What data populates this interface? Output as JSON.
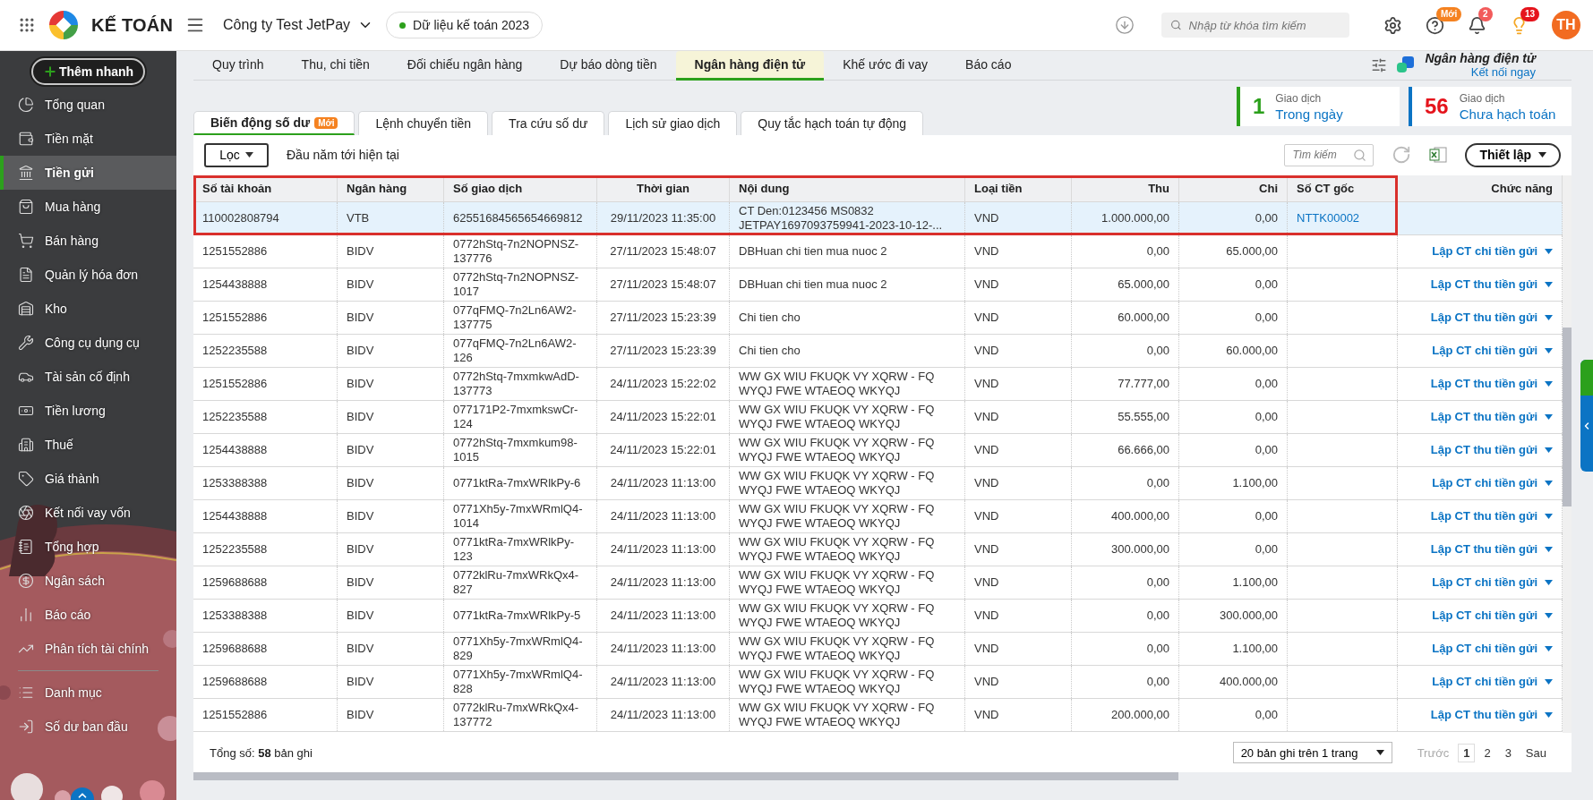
{
  "topbar": {
    "brand": "KẾ TOÁN",
    "company": "Công ty Test JetPay",
    "data_pill": "Dữ liệu kế toán 2023",
    "search": {
      "placeholder": "Nhập từ khóa tìm kiếm"
    },
    "help_badge": "Mới",
    "bell_badge": "2",
    "tips_badge": "13",
    "avatar": "TH"
  },
  "sidebar": {
    "add_button": "Thêm nhanh",
    "sections": [
      {
        "items": [
          {
            "label": "Tổng quan",
            "selected": false
          },
          {
            "label": "Tiền mặt",
            "selected": false
          },
          {
            "label": "Tiền gửi",
            "selected": true
          },
          {
            "label": "Mua hàng",
            "selected": false
          },
          {
            "label": "Bán hàng",
            "selected": false
          },
          {
            "label": "Quản lý hóa đơn",
            "selected": false
          },
          {
            "label": "Kho",
            "selected": false
          },
          {
            "label": "Công cụ dụng cụ",
            "selected": false
          },
          {
            "label": "Tài sản cố định",
            "selected": false
          },
          {
            "label": "Tiền lương",
            "selected": false
          },
          {
            "label": "Thuế",
            "selected": false
          },
          {
            "label": "Giá thành",
            "selected": false
          },
          {
            "label": "Kết nối vay vốn",
            "selected": false
          },
          {
            "label": "Tổng hợp",
            "selected": false
          },
          {
            "label": "Ngân sách",
            "selected": false
          },
          {
            "label": "Báo cáo",
            "selected": false
          },
          {
            "label": "Phân tích tài chính",
            "selected": false
          }
        ]
      },
      {
        "items": [
          {
            "label": "Danh mục",
            "selected": false
          },
          {
            "label": "Số dư ban đầu",
            "selected": false
          }
        ]
      }
    ]
  },
  "main_tabs": [
    {
      "label": "Quy trình",
      "selected": false
    },
    {
      "label": "Thu, chi tiền",
      "selected": false
    },
    {
      "label": "Đối chiếu ngân hàng",
      "selected": false
    },
    {
      "label": "Dự báo dòng tiền",
      "selected": false
    },
    {
      "label": "Ngân hàng điện tử",
      "selected": true
    },
    {
      "label": "Khế ước đi vay",
      "selected": false
    },
    {
      "label": "Báo cáo",
      "selected": false
    }
  ],
  "bank_connect": {
    "title": "Ngân hàng điện tử",
    "link": "Kết nối ngay"
  },
  "stats": [
    {
      "kind": "today",
      "count": "1",
      "caption": "Giao dịch",
      "link": "Trong ngày",
      "color": "#2ca01c"
    },
    {
      "kind": "unposted",
      "count": "56",
      "caption": "Giao dịch",
      "link": "Chưa hạch toán",
      "color": "#e5141c"
    }
  ],
  "sub_tabs": [
    {
      "label": "Biến động số dư",
      "badge": "Mới",
      "selected": true
    },
    {
      "label": "Lệnh chuyển tiền",
      "selected": false
    },
    {
      "label": "Tra cứu số dư",
      "selected": false
    },
    {
      "label": "Lịch sử giao dịch",
      "selected": false
    },
    {
      "label": "Quy tắc hạch toán tự động",
      "selected": false
    }
  ],
  "toolbar": {
    "filter_button": "Lọc",
    "period": "Đầu năm tới hiện tại",
    "search": {
      "placeholder": "Tìm kiếm"
    },
    "settings_button": "Thiết lập"
  },
  "table": {
    "highlight_frame": true,
    "columns": [
      "Số tài khoản",
      "Ngân hàng",
      "Số giao dịch",
      "Thời gian",
      "Nội dung",
      "Loại tiền",
      "Thu",
      "Chi",
      "Số CT gốc",
      "Chức năng"
    ],
    "rows": [
      {
        "account": "110002808794",
        "bank": "VTB",
        "transaction_no": "62551684565654669812",
        "time": "29/11/2023 11:35:00",
        "content": "CT Den:0123456 MS0832 JETPAY1697093759941-2023-10-12-...",
        "currency": "VND",
        "receipt": "1.000.000,00",
        "payment": "0,00",
        "source_doc": "NTTK00002",
        "selected": true
      },
      {
        "account": "1251552886",
        "bank": "BIDV",
        "transaction_no": "0772hStq-7n2NOPNSZ-137776",
        "time": "27/11/2023 15:48:07",
        "content": "DBHuan chi tien mua nuoc 2",
        "currency": "VND",
        "receipt": "0,00",
        "payment": "65.000,00",
        "action": "Lập CT chi tiền gửi",
        "selected": false
      },
      {
        "account": "1254438888",
        "bank": "BIDV",
        "transaction_no": "0772hStq-7n2NOPNSZ-1017",
        "time": "27/11/2023 15:48:07",
        "content": "DBHuan chi tien mua nuoc 2",
        "currency": "VND",
        "receipt": "65.000,00",
        "payment": "0,00",
        "action": "Lập CT thu tiền gửi",
        "selected": false
      },
      {
        "account": "1251552886",
        "bank": "BIDV",
        "transaction_no": "077qFMQ-7n2Ln6AW2-137775",
        "time": "27/11/2023 15:23:39",
        "content": "Chi tien cho",
        "currency": "VND",
        "receipt": "60.000,00",
        "payment": "0,00",
        "action": "Lập CT thu tiền gửi",
        "selected": false
      },
      {
        "account": "1252235588",
        "bank": "BIDV",
        "transaction_no": "077qFMQ-7n2Ln6AW2-126",
        "time": "27/11/2023 15:23:39",
        "content": "Chi tien cho",
        "currency": "VND",
        "receipt": "0,00",
        "payment": "60.000,00",
        "action": "Lập CT chi tiền gửi",
        "selected": false
      },
      {
        "account": "1251552886",
        "bank": "BIDV",
        "transaction_no": "0772hStq-7mxmkwAdD-137773",
        "time": "24/11/2023 15:22:02",
        "content": "WW GX WIU FKUQK VY XQRW - FQ WYQJ FWE WTAEOQ WKYQJ",
        "currency": "VND",
        "receipt": "77.777,00",
        "payment": "0,00",
        "action": "Lập CT thu tiền gửi",
        "selected": false
      },
      {
        "account": "1252235588",
        "bank": "BIDV",
        "transaction_no": "077171P2-7mxmkswCr-124",
        "time": "24/11/2023 15:22:01",
        "content": "WW GX WIU FKUQK VY XQRW - FQ WYQJ FWE WTAEOQ WKYQJ",
        "currency": "VND",
        "receipt": "55.555,00",
        "payment": "0,00",
        "action": "Lập CT thu tiền gửi",
        "selected": false
      },
      {
        "account": "1254438888",
        "bank": "BIDV",
        "transaction_no": "0772hStq-7mxmkum98-1015",
        "time": "24/11/2023 15:22:01",
        "content": "WW GX WIU FKUQK VY XQRW - FQ WYQJ FWE WTAEOQ WKYQJ",
        "currency": "VND",
        "receipt": "66.666,00",
        "payment": "0,00",
        "action": "Lập CT thu tiền gửi",
        "selected": false
      },
      {
        "account": "1253388388",
        "bank": "BIDV",
        "transaction_no": "0771ktRa-7mxWRlkPy-6",
        "time": "24/11/2023 11:13:00",
        "content": "WW GX WIU FKUQK VY XQRW - FQ WYQJ FWE WTAEOQ WKYQJ",
        "currency": "VND",
        "receipt": "0,00",
        "payment": "1.100,00",
        "action": "Lập CT chi tiền gửi",
        "selected": false
      },
      {
        "account": "1254438888",
        "bank": "BIDV",
        "transaction_no": "0771Xh5y-7mxWRmlQ4-1014",
        "time": "24/11/2023 11:13:00",
        "content": "WW GX WIU FKUQK VY XQRW - FQ WYQJ FWE WTAEOQ WKYQJ",
        "currency": "VND",
        "receipt": "400.000,00",
        "payment": "0,00",
        "action": "Lập CT thu tiền gửi",
        "selected": false
      },
      {
        "account": "1252235588",
        "bank": "BIDV",
        "transaction_no": "0771ktRa-7mxWRlkPy-123",
        "time": "24/11/2023 11:13:00",
        "content": "WW GX WIU FKUQK VY XQRW - FQ WYQJ FWE WTAEOQ WKYQJ",
        "currency": "VND",
        "receipt": "300.000,00",
        "payment": "0,00",
        "action": "Lập CT thu tiền gửi",
        "selected": false
      },
      {
        "account": "1259688688",
        "bank": "BIDV",
        "transaction_no": "0772klRu-7mxWRkQx4-827",
        "time": "24/11/2023 11:13:00",
        "content": "WW GX WIU FKUQK VY XQRW - FQ WYQJ FWE WTAEOQ WKYQJ",
        "currency": "VND",
        "receipt": "0,00",
        "payment": "1.100,00",
        "action": "Lập CT chi tiền gửi",
        "selected": false
      },
      {
        "account": "1253388388",
        "bank": "BIDV",
        "transaction_no": "0771ktRa-7mxWRlkPy-5",
        "time": "24/11/2023 11:13:00",
        "content": "WW GX WIU FKUQK VY XQRW - FQ WYQJ FWE WTAEOQ WKYQJ",
        "currency": "VND",
        "receipt": "0,00",
        "payment": "300.000,00",
        "action": "Lập CT chi tiền gửi",
        "selected": false
      },
      {
        "account": "1259688688",
        "bank": "BIDV",
        "transaction_no": "0771Xh5y-7mxWRmlQ4-829",
        "time": "24/11/2023 11:13:00",
        "content": "WW GX WIU FKUQK VY XQRW - FQ WYQJ FWE WTAEOQ WKYQJ",
        "currency": "VND",
        "receipt": "0,00",
        "payment": "1.100,00",
        "action": "Lập CT chi tiền gửi",
        "selected": false
      },
      {
        "account": "1259688688",
        "bank": "BIDV",
        "transaction_no": "0771Xh5y-7mxWRmlQ4-828",
        "time": "24/11/2023 11:13:00",
        "content": "WW GX WIU FKUQK VY XQRW - FQ WYQJ FWE WTAEOQ WKYQJ",
        "currency": "VND",
        "receipt": "0,00",
        "payment": "400.000,00",
        "action": "Lập CT chi tiền gửi",
        "selected": false
      },
      {
        "account": "1251552886",
        "bank": "BIDV",
        "transaction_no": "0772klRu-7mxWRkQx4-137772",
        "time": "24/11/2023 11:13:00",
        "content": "WW GX WIU FKUQK VY XQRW - FQ WYQJ FWE WTAEOQ WKYQJ",
        "currency": "VND",
        "receipt": "200.000,00",
        "payment": "0,00",
        "action": "Lập CT thu tiền gửi",
        "selected": false
      }
    ]
  },
  "footer": {
    "total": "Tổng số: **58** bản ghi",
    "page_size": "20 bản ghi trên 1 trang",
    "prev": "Trước",
    "prev_disabled": true,
    "pages": [
      {
        "label": "1",
        "selected": true
      },
      {
        "label": "2",
        "selected": false
      },
      {
        "label": "3",
        "selected": false
      }
    ],
    "next": "Sau"
  }
}
